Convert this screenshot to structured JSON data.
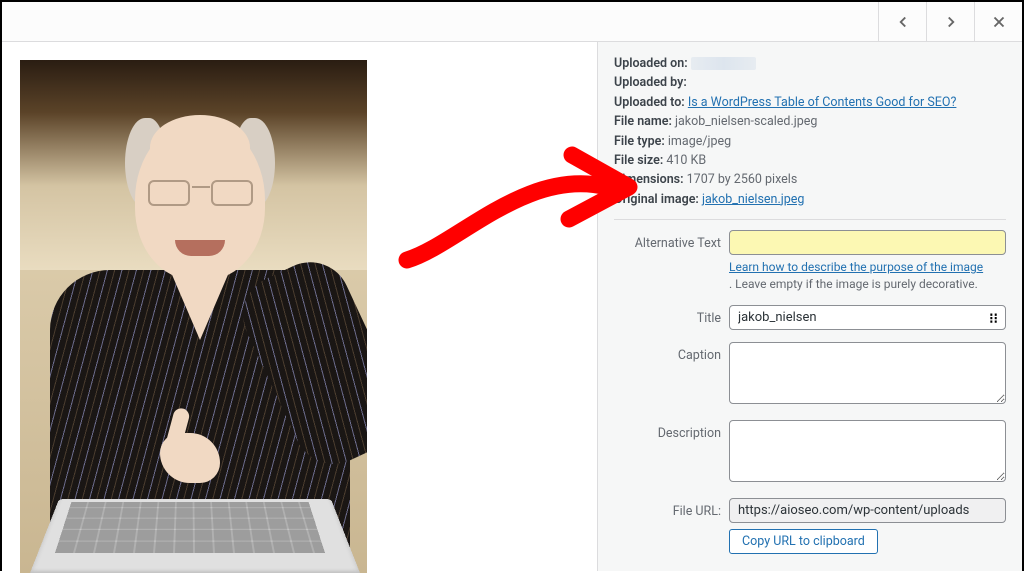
{
  "meta": {
    "uploaded_on_label": "Uploaded on:",
    "uploaded_on_value": "",
    "uploaded_by_label": "Uploaded by:",
    "uploaded_by_value": "",
    "uploaded_to_label": "Uploaded to:",
    "uploaded_to_link": "Is a WordPress Table of Contents Good for SEO?",
    "file_name_label": "File name:",
    "file_name_value": "jakob_nielsen-scaled.jpeg",
    "file_type_label": "File type:",
    "file_type_value": "image/jpeg",
    "file_size_label": "File size:",
    "file_size_value": "410 KB",
    "dimensions_label": "Dimensions:",
    "dimensions_value": "1707 by 2560 pixels",
    "original_image_label": "Original image:",
    "original_image_link": "jakob_nielsen.jpeg"
  },
  "fields": {
    "alt_label": "Alternative Text",
    "alt_value": "",
    "alt_help_link": "Learn how to describe the purpose of the image",
    "alt_help_text": ". Leave empty if the image is purely decorative.",
    "title_label": "Title",
    "title_value": "jakob_nielsen",
    "caption_label": "Caption",
    "caption_value": "",
    "description_label": "Description",
    "description_value": "",
    "file_url_label": "File URL:",
    "file_url_value": "https://aioseo.com/wp-content/uploads",
    "copy_url_label": "Copy URL to clipboard"
  }
}
